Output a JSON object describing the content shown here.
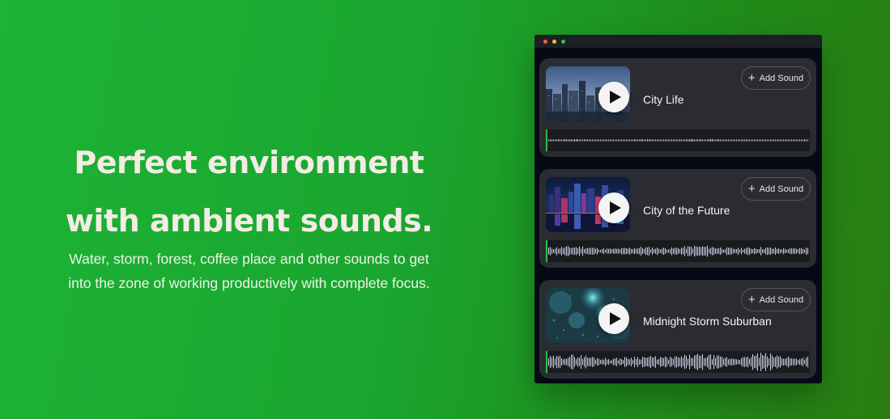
{
  "hero": {
    "title_line1": "Perfect environment",
    "title_line2": "with ambient sounds.",
    "subtitle_line1": "Water, storm, forest, coffee place and other sounds to get",
    "subtitle_line2": "into the zone of working productively with complete focus."
  },
  "window": {
    "controls": [
      "close",
      "minimize",
      "maximize"
    ]
  },
  "colors": {
    "accent_green": "#27c04a",
    "card_bg": "#2b2c31",
    "window_bg": "#060a14"
  },
  "sounds": [
    {
      "title": "City Life",
      "add_label": "Add Sound",
      "icon": "play-icon"
    },
    {
      "title": "City of the Future",
      "add_label": "Add Sound",
      "icon": "play-icon"
    },
    {
      "title": "Midnight Storm Suburban",
      "add_label": "Add Sound",
      "icon": "play-icon"
    }
  ]
}
